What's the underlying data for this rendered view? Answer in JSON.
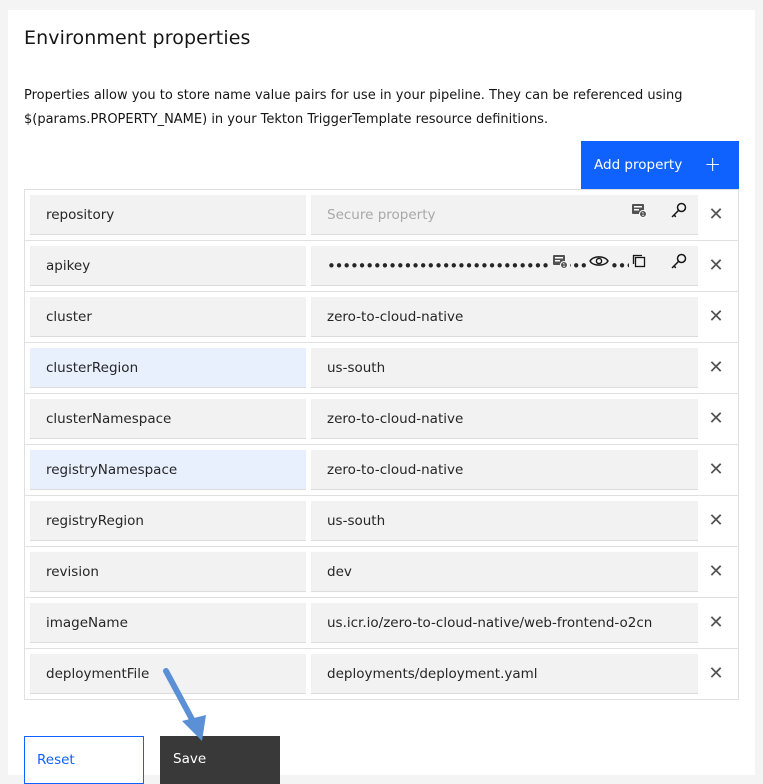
{
  "page": {
    "title": "Environment properties",
    "description": "Properties allow you to store name value pairs for use in your pipeline. They can be referenced using $(params.PROPERTY_NAME) in your Tekton TriggerTemplate resource definitions."
  },
  "toolbar": {
    "add_label": "Add property",
    "add_icon": "+"
  },
  "properties": [
    {
      "name": "repository",
      "value": "",
      "placeholder": "Secure property",
      "type": "secure",
      "highlighted": false,
      "icons": [
        "secrets-picker-icon",
        "key-icon"
      ]
    },
    {
      "name": "apikey",
      "value": "••••••••••••••••••••••••••••••••••••••••••",
      "placeholder": "",
      "type": "secure-filled",
      "highlighted": false,
      "icons": [
        "secrets-picker-icon",
        "eye-icon",
        "copy-icon",
        "key-icon"
      ]
    },
    {
      "name": "cluster",
      "value": "zero-to-cloud-native",
      "placeholder": "",
      "type": "text",
      "highlighted": false,
      "icons": []
    },
    {
      "name": "clusterRegion",
      "value": "us-south",
      "placeholder": "",
      "type": "text",
      "highlighted": true,
      "icons": []
    },
    {
      "name": "clusterNamespace",
      "value": "zero-to-cloud-native",
      "placeholder": "",
      "type": "text",
      "highlighted": false,
      "icons": []
    },
    {
      "name": "registryNamespace",
      "value": "zero-to-cloud-native",
      "placeholder": "",
      "type": "text",
      "highlighted": true,
      "icons": []
    },
    {
      "name": "registryRegion",
      "value": "us-south",
      "placeholder": "",
      "type": "text",
      "highlighted": false,
      "icons": []
    },
    {
      "name": "revision",
      "value": "dev",
      "placeholder": "",
      "type": "text",
      "highlighted": false,
      "icons": []
    },
    {
      "name": "imageName",
      "value": "us.icr.io/zero-to-cloud-native/web-frontend-o2cn",
      "placeholder": "",
      "type": "text",
      "highlighted": false,
      "icons": []
    },
    {
      "name": "deploymentFile",
      "value": "deployments/deployment.yaml",
      "placeholder": "",
      "type": "text",
      "highlighted": false,
      "icons": []
    }
  ],
  "footer": {
    "reset_label": "Reset",
    "save_label": "Save"
  },
  "colors": {
    "primary": "#0f62fe",
    "save_bg": "#393939",
    "highlight": "#e8effd",
    "annotation_arrow": "#5b8fd6"
  }
}
